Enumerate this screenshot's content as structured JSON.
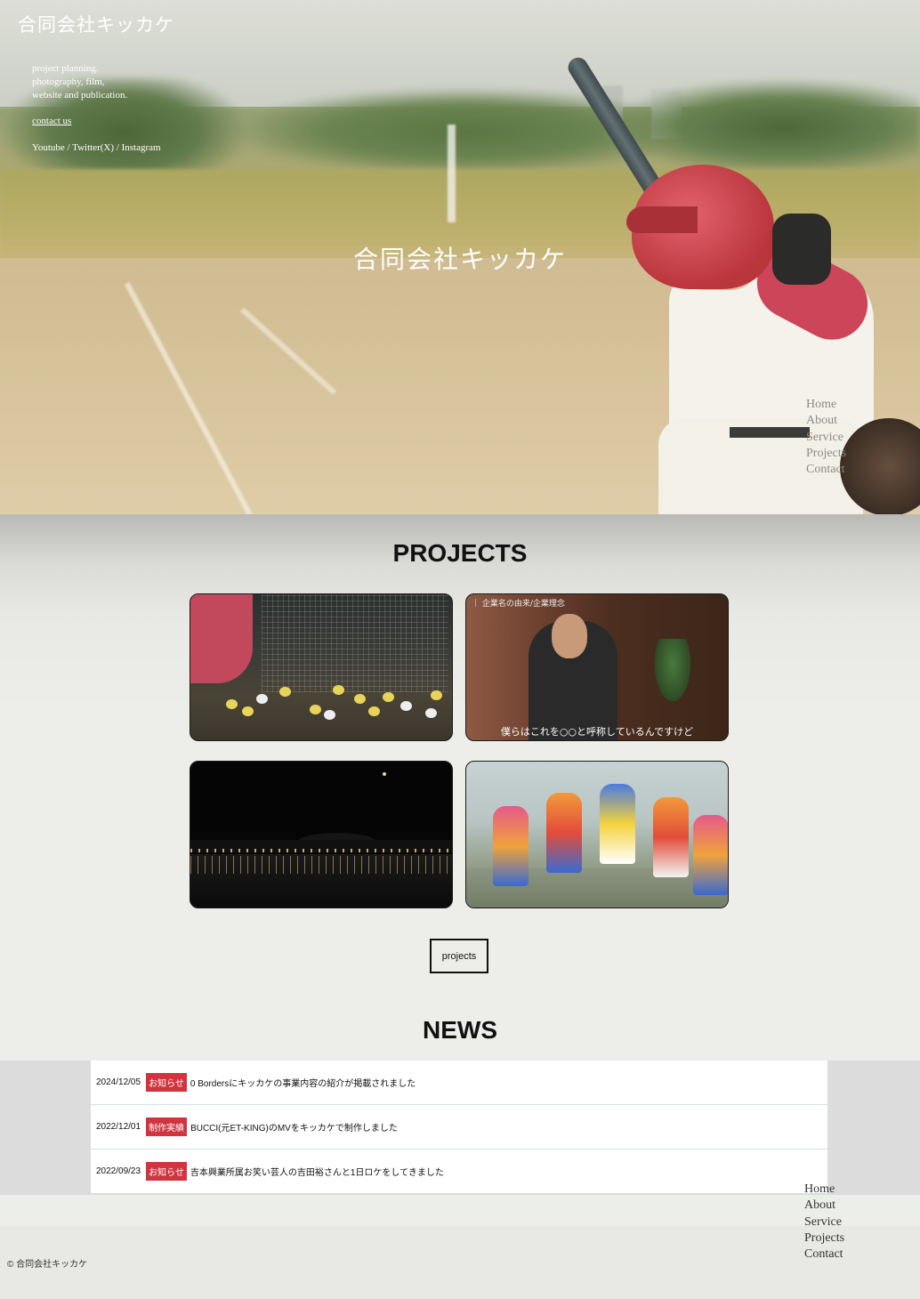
{
  "header": {
    "brand": "合同会社キッカケ",
    "tagline_lines": [
      "project planning.",
      "photography, film,",
      "website and publication."
    ],
    "contact_label": "contact us",
    "social_label": "Youtube / Twitter(X) / Instagram"
  },
  "hero": {
    "title": "合同会社キッカケ"
  },
  "nav": {
    "items": [
      "Home",
      "About",
      "Service",
      "Projects",
      "Contact"
    ]
  },
  "projects": {
    "title": "PROJECTS",
    "cards": [
      {
        "caption": ""
      },
      {
        "label": "｜ 企業名の由来/企業理念",
        "caption": "僕らはこれを○○と呼称しているんですけど"
      },
      {
        "caption": ""
      },
      {
        "caption": ""
      }
    ],
    "button_label": "projects"
  },
  "news": {
    "title": "NEWS",
    "items": [
      {
        "date": "2024/12/05",
        "tag": "お知らせ",
        "text": "0 Bordersにキッカケの事業内容の紹介が掲載されました"
      },
      {
        "date": "2022/12/01",
        "tag": "制作実績",
        "text": "BUCCI(元ET-KING)のMVをキッカケで制作しました"
      },
      {
        "date": "2022/09/23",
        "tag": "お知らせ",
        "text": "吉本興業所属お笑い芸人の吉田裕さんと1日ロケをしてきました"
      }
    ]
  },
  "footer": {
    "copyright": "© 合同会社キッカケ"
  },
  "colors": {
    "tag_red": "#d0353f",
    "background": "#edeee9"
  }
}
